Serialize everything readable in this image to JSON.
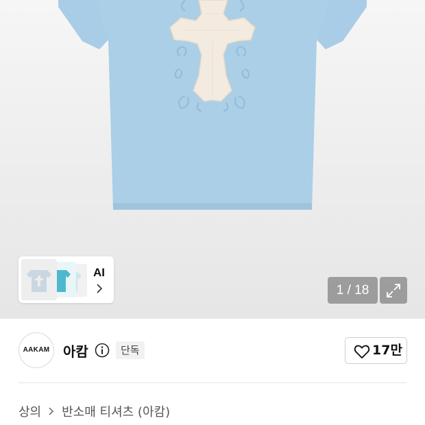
{
  "gallery": {
    "ai_label": "AI",
    "page_counter": "1 / 18",
    "icons": {
      "expand": "expand-icon",
      "chevron": "chevron-right-icon"
    },
    "colors": {
      "shirt": "#a9cde6",
      "patch": "#f3ebe0",
      "embroidery": "#8fb6d4"
    }
  },
  "brand": {
    "logo_text": "AAKAM",
    "name": "아캄",
    "badge": "단독",
    "info_icon": "info-icon"
  },
  "like": {
    "icon": "heart-icon",
    "count": "17만"
  },
  "breadcrumb": {
    "items": [
      "상의",
      "반소매 티셔츠 (아캄)"
    ],
    "separator_icon": "chevron-right-icon"
  }
}
